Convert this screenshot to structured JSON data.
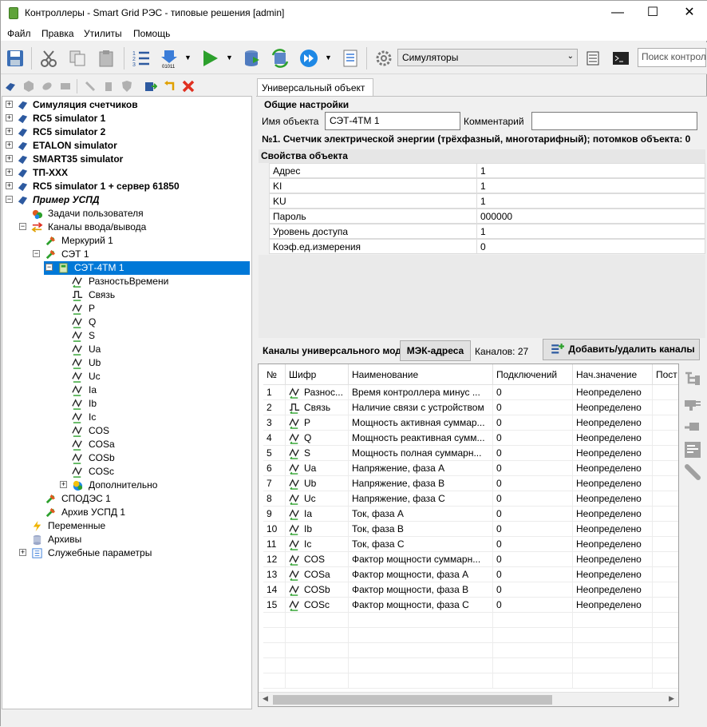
{
  "window": {
    "title": "Контроллеры - Smart Grid РЭС - типовые решения [admin]"
  },
  "menu": [
    "Файл",
    "Правка",
    "Утилиты",
    "Помощь"
  ],
  "toolbar": {
    "simulators_value": "Симуляторы",
    "search_placeholder": "Поиск контроллер"
  },
  "tree": [
    {
      "label": "Симуляция счетчиков",
      "style": "bold"
    },
    {
      "label": "RC5 simulator 1",
      "style": "bold"
    },
    {
      "label": "RC5 simulator 2",
      "style": "bold"
    },
    {
      "label": "ETALON simulator",
      "style": "bold"
    },
    {
      "label": "SMART35 simulator",
      "style": "bold"
    },
    {
      "label": "ТП-XXX",
      "style": "bold"
    },
    {
      "label": "RC5 simulator 1 + сервер 61850",
      "style": "bold"
    },
    {
      "label": "Пример УСПД",
      "style": "bold-italic"
    },
    {
      "label": "Задачи пользователя"
    },
    {
      "label": "Каналы ввода/вывода"
    },
    {
      "label": "Меркурий 1"
    },
    {
      "label": "СЭТ 1"
    },
    {
      "label": "СЭТ-4ТМ 1"
    },
    {
      "label": "РазностьВремени"
    },
    {
      "label": "Связь"
    },
    {
      "label": "P"
    },
    {
      "label": "Q"
    },
    {
      "label": "S"
    },
    {
      "label": "Ua"
    },
    {
      "label": "Ub"
    },
    {
      "label": "Uc"
    },
    {
      "label": "Ia"
    },
    {
      "label": "Ib"
    },
    {
      "label": "Ic"
    },
    {
      "label": "COS"
    },
    {
      "label": "COSa"
    },
    {
      "label": "COSb"
    },
    {
      "label": "COSc"
    },
    {
      "label": "Дополнительно"
    },
    {
      "label": "СПОДЭС 1"
    },
    {
      "label": "Архив УСПД 1"
    },
    {
      "label": "Переменные"
    },
    {
      "label": "Архивы"
    },
    {
      "label": "Служебные параметры"
    }
  ],
  "tab": {
    "label": "Универсальный объект"
  },
  "general": {
    "title": "Общие настройки",
    "name_label": "Имя объекта",
    "name_value": "СЭТ-4ТМ 1",
    "comment_label": "Комментарий",
    "comment_value": "",
    "info": "№1. Счетчик электрической энергии (трёхфазный, многотарифный); потомков объекта: 0"
  },
  "props": {
    "title": "Свойства объекта",
    "rows": [
      {
        "key": "Адрес",
        "value": "1"
      },
      {
        "key": "KI",
        "value": "1"
      },
      {
        "key": "KU",
        "value": "1"
      },
      {
        "key": "Пароль",
        "value": "000000"
      },
      {
        "key": "Уровень доступа",
        "value": "1"
      },
      {
        "key": "Коэф.ед.измерения",
        "value": "0"
      }
    ]
  },
  "channels": {
    "label": "Каналы универсального модуля",
    "iec_button": "МЭК-адреса",
    "count_text": "Каналов: 27",
    "add_button": "Добавить/удалить каналы",
    "columns": [
      "№",
      "Шифр",
      "Наименование",
      "Подключений",
      "Нач.значение",
      "Пост"
    ],
    "rows": [
      [
        "1",
        "Разнос...",
        "Время контроллера минус ...",
        "0",
        "Неопределено",
        "wave"
      ],
      [
        "2",
        "Связь",
        "Наличие связи с устройством",
        "0",
        "Неопределено",
        "pulse"
      ],
      [
        "3",
        "P",
        "Мощность активная суммар...",
        "0",
        "Неопределено",
        "wave"
      ],
      [
        "4",
        "Q",
        "Мощность реактивная сумм...",
        "0",
        "Неопределено",
        "wave"
      ],
      [
        "5",
        "S",
        "Мощность полная суммарн...",
        "0",
        "Неопределено",
        "wave"
      ],
      [
        "6",
        "Ua",
        "Напряжение, фаза A",
        "0",
        "Неопределено",
        "wave"
      ],
      [
        "7",
        "Ub",
        "Напряжение, фаза B",
        "0",
        "Неопределено",
        "wave"
      ],
      [
        "8",
        "Uc",
        "Напряжение, фаза C",
        "0",
        "Неопределено",
        "wave"
      ],
      [
        "9",
        "Ia",
        "Ток, фаза A",
        "0",
        "Неопределено",
        "wave"
      ],
      [
        "10",
        "Ib",
        "Ток, фаза B",
        "0",
        "Неопределено",
        "wave"
      ],
      [
        "11",
        "Ic",
        "Ток, фаза C",
        "0",
        "Неопределено",
        "wave"
      ],
      [
        "12",
        "COS",
        "Фактор мощности суммарн...",
        "0",
        "Неопределено",
        "wave"
      ],
      [
        "13",
        "COSa",
        "Фактор мощности, фаза A",
        "0",
        "Неопределено",
        "wave"
      ],
      [
        "14",
        "COSb",
        "Фактор мощности, фаза B",
        "0",
        "Неопределено",
        "wave"
      ],
      [
        "15",
        "COSc",
        "Фактор мощности, фаза C",
        "0",
        "Неопределено",
        "wave"
      ]
    ]
  }
}
